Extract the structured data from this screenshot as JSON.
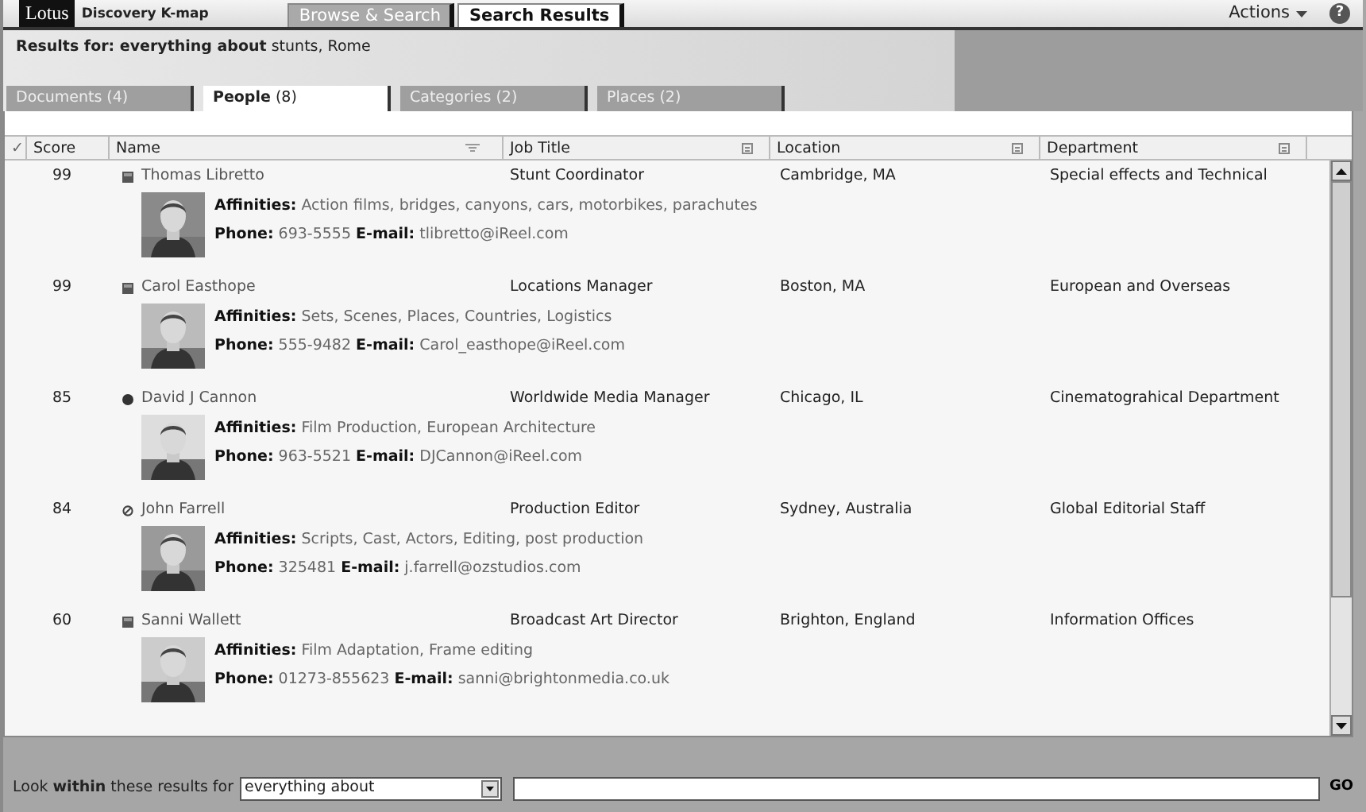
{
  "app": {
    "logo": "Lotus",
    "product": "Discovery K-map",
    "actions": "Actions",
    "help": "?"
  },
  "main_tabs": [
    {
      "label": "Browse & Search",
      "selected": false
    },
    {
      "label": "Search Results",
      "selected": true
    }
  ],
  "results_for": "**Results for: everything about** stunts, Rome",
  "result_tabs": [
    {
      "label": "Documents (4)",
      "selected": false
    },
    {
      "label": "**People** (8)",
      "selected": true
    },
    {
      "label": "Categories (2)",
      "selected": false
    },
    {
      "label": "Places (2)",
      "selected": false
    }
  ],
  "table": {
    "columns": [
      "✓",
      "Score",
      "Name",
      "Job Title",
      "Location",
      "Department"
    ],
    "rows": [
      {
        "score": "99",
        "kind": "square",
        "name": "Thomas Libretto",
        "job_title": "Stunt Coordinator",
        "location": "Cambridge, MA",
        "department": "Special effects and Technical",
        "affinities": "**Affinities:** Action films, bridges, canyons, cars, motorbikes, parachutes",
        "contact": "**Phone:** 693-5555 **E-mail:** tlibretto@iReel.com"
      },
      {
        "score": "99",
        "kind": "square",
        "name": "Carol Easthope",
        "job_title": "Locations Manager",
        "location": "Boston, MA",
        "department": "European and Overseas",
        "affinities": "**Affinities:** Sets, Scenes, Places, Countries, Logistics",
        "contact": "**Phone:** 555-9482 **E-mail:** Carol_easthope@iReel.com"
      },
      {
        "score": "85",
        "kind": "dot",
        "name": "David J Cannon",
        "job_title": "Worldwide Media Manager",
        "location": "Chicago, IL",
        "department": "Cinematograhical Department",
        "affinities": "**Affinities:** Film Production, European Architecture",
        "contact": "**Phone:** 963-5521 **E-mail:** DJCannon@iReel.com"
      },
      {
        "score": "84",
        "kind": "blocked",
        "name": "John Farrell",
        "job_title": "Production Editor",
        "location": "Sydney, Australia",
        "department": "Global Editorial Staff",
        "affinities": "**Affinities:** Scripts, Cast, Actors, Editing, post production",
        "contact": "**Phone:** 325481 **E-mail:** j.farrell@ozstudios.com"
      },
      {
        "score": "60",
        "kind": "square",
        "name": "Sanni Wallett",
        "job_title": "Broadcast Art Director",
        "location": "Brighton, England",
        "department": "Information Offices",
        "affinities": "**Affinities:** Film Adaptation, Frame editing",
        "contact": "**Phone:** 01273-855623 **E-mail:** sanni@brightonmedia.co.uk"
      }
    ]
  },
  "filter": {
    "label": "Look **within** these results for",
    "scope": "everything about",
    "go": "GO"
  }
}
